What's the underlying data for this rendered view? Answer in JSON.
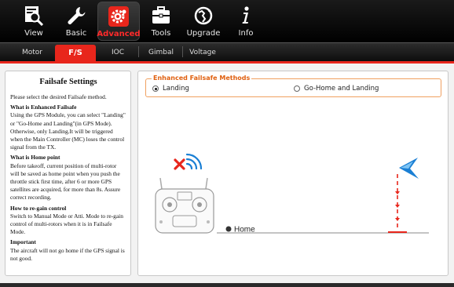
{
  "toolbar": {
    "items": [
      {
        "label": "View",
        "icon": "magnifier-icon"
      },
      {
        "label": "Basic",
        "icon": "wrench-icon"
      },
      {
        "label": "Advanced",
        "icon": "gear-icon"
      },
      {
        "label": "Tools",
        "icon": "toolbox-icon"
      },
      {
        "label": "Upgrade",
        "icon": "globe-refresh-icon"
      },
      {
        "label": "Info",
        "icon": "info-icon"
      }
    ],
    "active": "Advanced"
  },
  "subtabs": {
    "items": [
      "Motor",
      "F/S",
      "IOC",
      "Gimbal",
      "Voltage"
    ],
    "active": "F/S"
  },
  "left_panel": {
    "title": "Failsafe Settings",
    "intro": "Please select the desired Failsafe method.",
    "sections": [
      {
        "heading": "What is Enhanced Failsafe",
        "body": "Using the GPS Module, you can select \"Landing\" or \"Go-Home and Landing\"(in GPS Mode). Otherwise, only Landing.It will be triggered when the Main Controller (MC) loses the control signal from the TX."
      },
      {
        "heading": "What is Home point",
        "body": "Before takeoff, current position of multi-rotor will be saved as home point when you push the throttle stick first time, after 6 or more GPS satellites are acquired, for more than 8s. Assure correct recording."
      },
      {
        "heading": "How to re-gain control",
        "body": "Switch to Manual Mode or Atti. Mode to re-gain control of multi-rotors when it is in Failsafe Mode."
      },
      {
        "heading": "Important",
        "body": "The aircraft will not go home if the GPS signal is not good."
      }
    ]
  },
  "right_panel": {
    "group_title": "Enhanced Failsafe Methods",
    "options": [
      {
        "label": "Landing",
        "selected": true
      },
      {
        "label": "Go-Home and Landing",
        "selected": false
      }
    ],
    "home_label": "Home"
  },
  "colors": {
    "accent_red": "#e8261c",
    "legend_orange": "#e06010",
    "signal_blue": "#1a7fd4",
    "cross_red": "#e8261c"
  }
}
